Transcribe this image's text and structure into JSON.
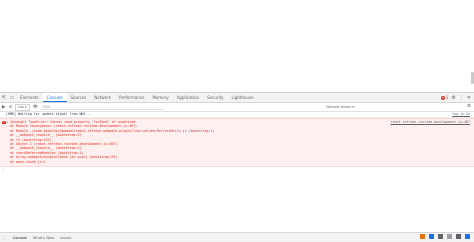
{
  "devtools": {
    "tabs": [
      "Elements",
      "Console",
      "Sources",
      "Network",
      "Performance",
      "Memory",
      "Application",
      "Security",
      "Lighthouse"
    ],
    "active_tab": "Console",
    "error_count": "1"
  },
  "toolbar": {
    "context": "top",
    "filter_placeholder": "Filter",
    "levels": "Default levels"
  },
  "console": {
    "info": {
      "text": "[HMR] Waiting for update signal from WDS...",
      "source": "log.js:24"
    },
    "error": {
      "source": "react-refresh-runtime.development.js:487",
      "lines": [
        "Uncaught TypeError: Cannot read property 'forEach' of undefined",
        "at Module.<anonymous> (react-refresh-runtime.development.js:487)",
        "at Module../node_modules/@pmmmwh/react-refresh-webpack-plugin/lib/runtime/RefreshUtils.js (bootstrap:1)",
        "at __webpack_require__ (bootstrap:1)",
        "at fn (bootstrap:151)",
        "at Object.1 (react-refresh-runtime.development.js:487)",
        "at __webpack_require__ (bootstrap:1)",
        "at checkDeferredModules (bootstrap:1)",
        "at Array.webpackJsonpCallback [as push] (bootstrap:29)",
        "at main.chunk.js:1"
      ]
    }
  },
  "drawer": {
    "tabs": [
      "Console",
      "What's New",
      "Issues"
    ]
  }
}
